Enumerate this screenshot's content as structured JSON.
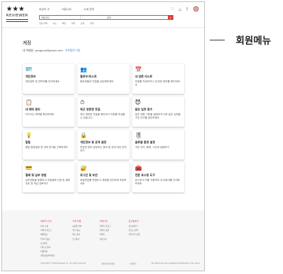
{
  "header": {
    "logo_stars": "★★★",
    "logo_word": "REVIEWER",
    "nav": [
      "리뷰어 가",
      "커뮤니티",
      "소개·문의"
    ],
    "search": {
      "option": "카테고리",
      "query": "검색",
      "button_icon": "search-icon"
    },
    "filters": [
      "맛집·카페",
      "숙소",
      "체험",
      "여행",
      "쇼핑",
      "전체"
    ],
    "icons": [
      "heart-icon",
      "bell-icon",
      "share-icon",
      "user-avatar"
    ]
  },
  "page": {
    "title": "계정",
    "email_label": "내 이메일: yongjuna@gmail.com",
    "profile_link": "프로필로 이동"
  },
  "cards": [
    {
      "icon": "id-card-icon",
      "glyph": "🪪",
      "title": "개인정보",
      "desc": "개인정보 및 연락처를 관리하세요"
    },
    {
      "icon": "group-icon",
      "glyph": "👥",
      "title": "팔로우/리스트",
      "desc": "팔로워들의 맛집을 공유해보세요"
    },
    {
      "icon": "calendar-icon",
      "glyph": "📅",
      "title": "내 방문 리스트",
      "desc": "리뷰를 작성하거나 내 방문 정보를 확인하세요"
    },
    {
      "icon": "document-icon",
      "glyph": "📋",
      "title": "내 예약 관리",
      "desc": "다가오는 예약을 확인하세요"
    },
    {
      "icon": "clock-icon",
      "glyph": "⏱",
      "title": "최근 방문한 맛집",
      "desc": "최근 방문한 맛집을 확인하고 리뷰를 작성할 수 있습니다"
    },
    {
      "icon": "devil-icon",
      "glyph": "😈",
      "title": "같은 입맛 찾기",
      "desc": "입맛 취향 기준을 설정하여 나와 같은 입맛을 가진 친구를 찾아보세요"
    },
    {
      "icon": "bulb-icon",
      "glyph": "💡",
      "title": "알림",
      "desc": "알림 환경설정 및 연락 방식을 선택하세요"
    },
    {
      "icon": "lock-icon",
      "glyph": "🔒",
      "title": "개인정보 및 공개 설정",
      "desc": "민감한 정보 공유하는 정보 및 공개 대상 관리하기"
    },
    {
      "icon": "sliders-icon",
      "glyph": "🎚",
      "title": "글로벌 환경 설정",
      "desc": "기본 언어, 통화, 시간대 설정하기"
    },
    {
      "icon": "card-icon",
      "glyph": "💳",
      "title": "결제 및 납부 방법",
      "desc": "납부방법을 등록하고 자동결제 신청 및 결제 쿠폰 및 적금 검토하기"
    },
    {
      "icon": "shield-icon",
      "glyph": "🔐",
      "title": "로그인 및 보안",
      "desc": "비밀번호를 변경하고 계정을 안전하게 보호하세요"
    },
    {
      "icon": "tools-icon",
      "glyph": "🧰",
      "title": "전문 호스팅 도구",
      "desc": "호스팅 도구를 사용하여 내 리뷰어를 관리해보세요"
    }
  ],
  "footer": {
    "columns": [
      {
        "heading": "리뷰어 소개",
        "items": [
          "회사 소개",
          "리뷰어 블로그",
          "채용정보",
          "투자자 정보",
          "프로젝트",
          "지원 및 문의",
          "이용약관",
          "개인정보처리방침"
        ]
      },
      {
        "heading": "고객 지원",
        "items": [
          "도움말 센터",
          "안전 정보",
          "취소 옵션",
          "신고하기"
        ]
      },
      {
        "heading": "커뮤니티",
        "items": [
          "리뷰어 블로그",
          "리뷰어 포럼",
          "이벤트",
          "파트너십"
        ]
      },
      {
        "heading": "호스팅하기",
        "items": [
          "호스팅하기",
          "리소스 센터",
          "커뮤니티 포럼"
        ]
      }
    ],
    "bottom": [
      "Copyright © 2023 Reviewer Inc. All rights reserved.",
      "개인정보처리방침",
      "이용약관",
      "All trademarks are registered trademarks of the owner."
    ]
  },
  "annotation": {
    "label": "회원메뉴"
  },
  "colors": {
    "accent": "#d94040",
    "link": "#2f7fd6"
  }
}
